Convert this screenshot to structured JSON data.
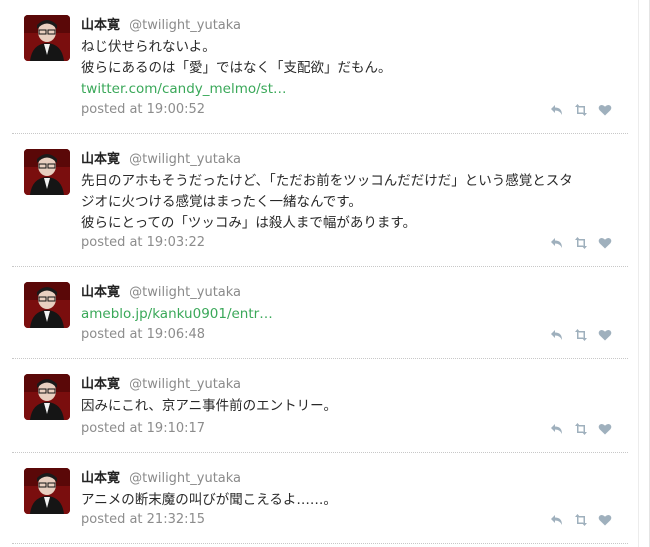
{
  "tweets": [
    {
      "name": "山本寛",
      "handle": "@twilight_yutaka",
      "lines": [
        "ねじ伏せられないよ。",
        "彼らにあるのは「愛」ではなく「支配欲」だもん。"
      ],
      "link": "twitter.com/candy_melmo/st…",
      "time": "posted at 19:00:52"
    },
    {
      "name": "山本寛",
      "handle": "@twilight_yutaka",
      "lines": [
        "先日のアホもそうだったけど、「ただお前をツッコんだだけだ」という感覚とスタ",
        "ジオに火つける感覚はまったく一緒なんです。",
        "彼らにとっての「ツッコみ」は殺人まで幅があります。"
      ],
      "link": "",
      "time": "posted at 19:03:22"
    },
    {
      "name": "山本寛",
      "handle": "@twilight_yutaka",
      "lines": [],
      "link": "ameblo.jp/kanku0901/entr…",
      "time": "posted at 19:06:48"
    },
    {
      "name": "山本寛",
      "handle": "@twilight_yutaka",
      "lines": [
        "因みにこれ、京アニ事件前のエントリー。"
      ],
      "link": "",
      "time": "posted at 19:10:17"
    },
    {
      "name": "山本寛",
      "handle": "@twilight_yutaka",
      "lines": [
        "アニメの断末魔の叫びが聞こえるよ……。"
      ],
      "link": "",
      "time": "posted at 21:32:15"
    }
  ],
  "icons": {
    "reply": "reply-icon",
    "retweet": "retweet-icon",
    "favorite": "heart-icon"
  },
  "colors": {
    "link": "#3aa859",
    "meta": "#8c8c8c",
    "action": "#9fb0bd",
    "divider": "#c8c8c8"
  }
}
